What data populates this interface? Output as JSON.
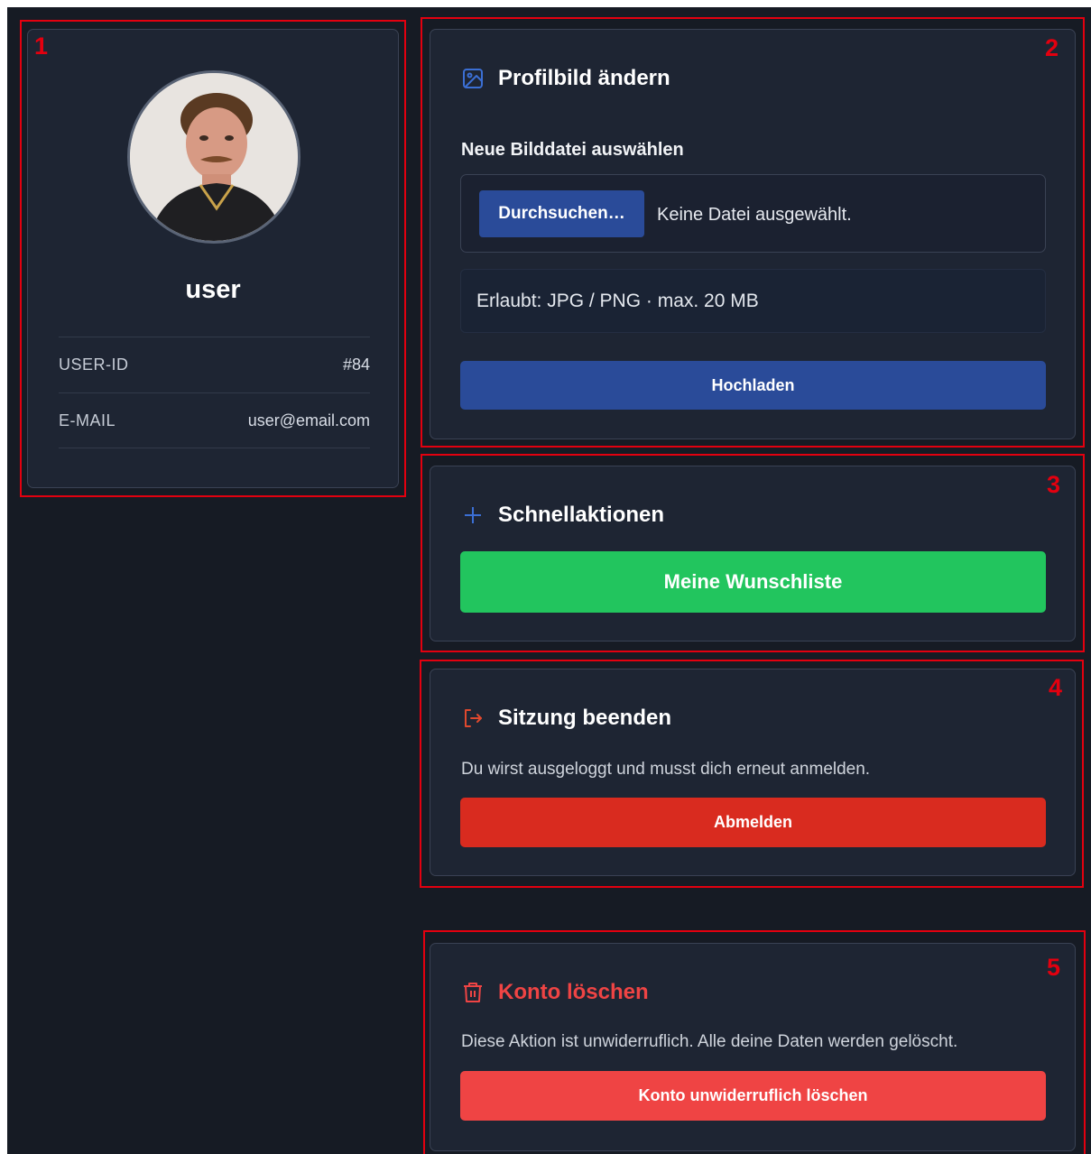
{
  "profile": {
    "username": "user",
    "fields": [
      {
        "key": "USER-ID",
        "value": "#84"
      },
      {
        "key": "E-MAIL",
        "value": "user@email.com"
      }
    ]
  },
  "upload": {
    "title": "Profilbild ändern",
    "label": "Neue Bilddatei auswählen",
    "browse_label": "Durchsuchen…",
    "file_status": "Keine Datei ausgewählt.",
    "hint": "Erlaubt: JPG / PNG · max. 20 MB",
    "submit_label": "Hochladen"
  },
  "quick": {
    "title": "Schnellaktionen",
    "wishlist_label": "Meine Wunschliste"
  },
  "session": {
    "title": "Sitzung beenden",
    "description": "Du wirst ausgeloggt und musst dich erneut anmelden.",
    "logout_label": "Abmelden"
  },
  "delete": {
    "title": "Konto löschen",
    "description": "Diese Aktion ist unwiderruflich. Alle deine Daten werden gelöscht.",
    "delete_label": "Konto unwiderruflich löschen"
  },
  "annotations": [
    "1",
    "2",
    "3",
    "4",
    "5"
  ],
  "colors": {
    "background": "#161b24",
    "card": "#1e2533",
    "primary": "#2a4b99",
    "success": "#22c55e",
    "danger": "#d92b1f",
    "danger_light": "#ef4444",
    "annotation": "#e3000f"
  },
  "icons": [
    "image-icon",
    "plus-icon",
    "logout-icon",
    "trash-icon"
  ]
}
